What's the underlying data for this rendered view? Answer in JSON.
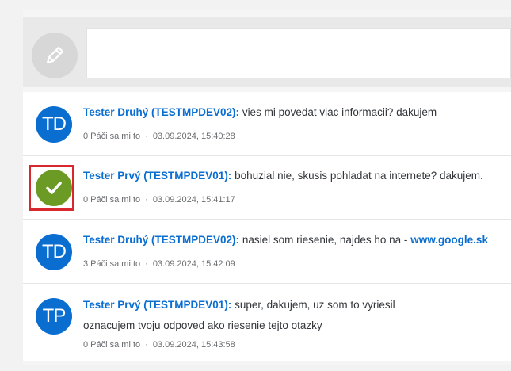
{
  "composer": {
    "icon": "pencil-icon"
  },
  "posts": [
    {
      "initials": "TD",
      "author": "Tester Druhý (TESTMPDEV02):",
      "text": "vies mi povedat viac informacii? dakujem",
      "likes": "0 Páči sa mi to",
      "separator": "·",
      "timestamp": "03.09.2024, 15:40:28"
    },
    {
      "icon": "checkmark-icon",
      "author": "Tester Prvý (TESTMPDEV01):",
      "text": "bohuzial nie, skusis pohladat na internete? dakujem.",
      "likes": "0 Páči sa mi to",
      "separator": "·",
      "timestamp": "03.09.2024, 15:41:17"
    },
    {
      "initials": "TD",
      "author": "Tester Druhý (TESTMPDEV02):",
      "text": "nasiel som riesenie, najdes ho na - ",
      "link": "www.google.sk",
      "likes": "3 Páči sa mi to",
      "separator": "·",
      "timestamp": "03.09.2024, 15:42:09"
    },
    {
      "initials": "TP",
      "author": "Tester Prvý (TESTMPDEV01):",
      "text": "super, dakujem, uz som to vyriesil",
      "text2": "oznacujem tvoju odpoved ako riesenie tejto otazky",
      "likes": "0 Páči sa mi to",
      "separator": "·",
      "timestamp": "03.09.2024, 15:43:58"
    }
  ],
  "colors": {
    "accent": "#0a6ed1",
    "solution": "#6b9b24",
    "highlight": "#d9272e"
  }
}
